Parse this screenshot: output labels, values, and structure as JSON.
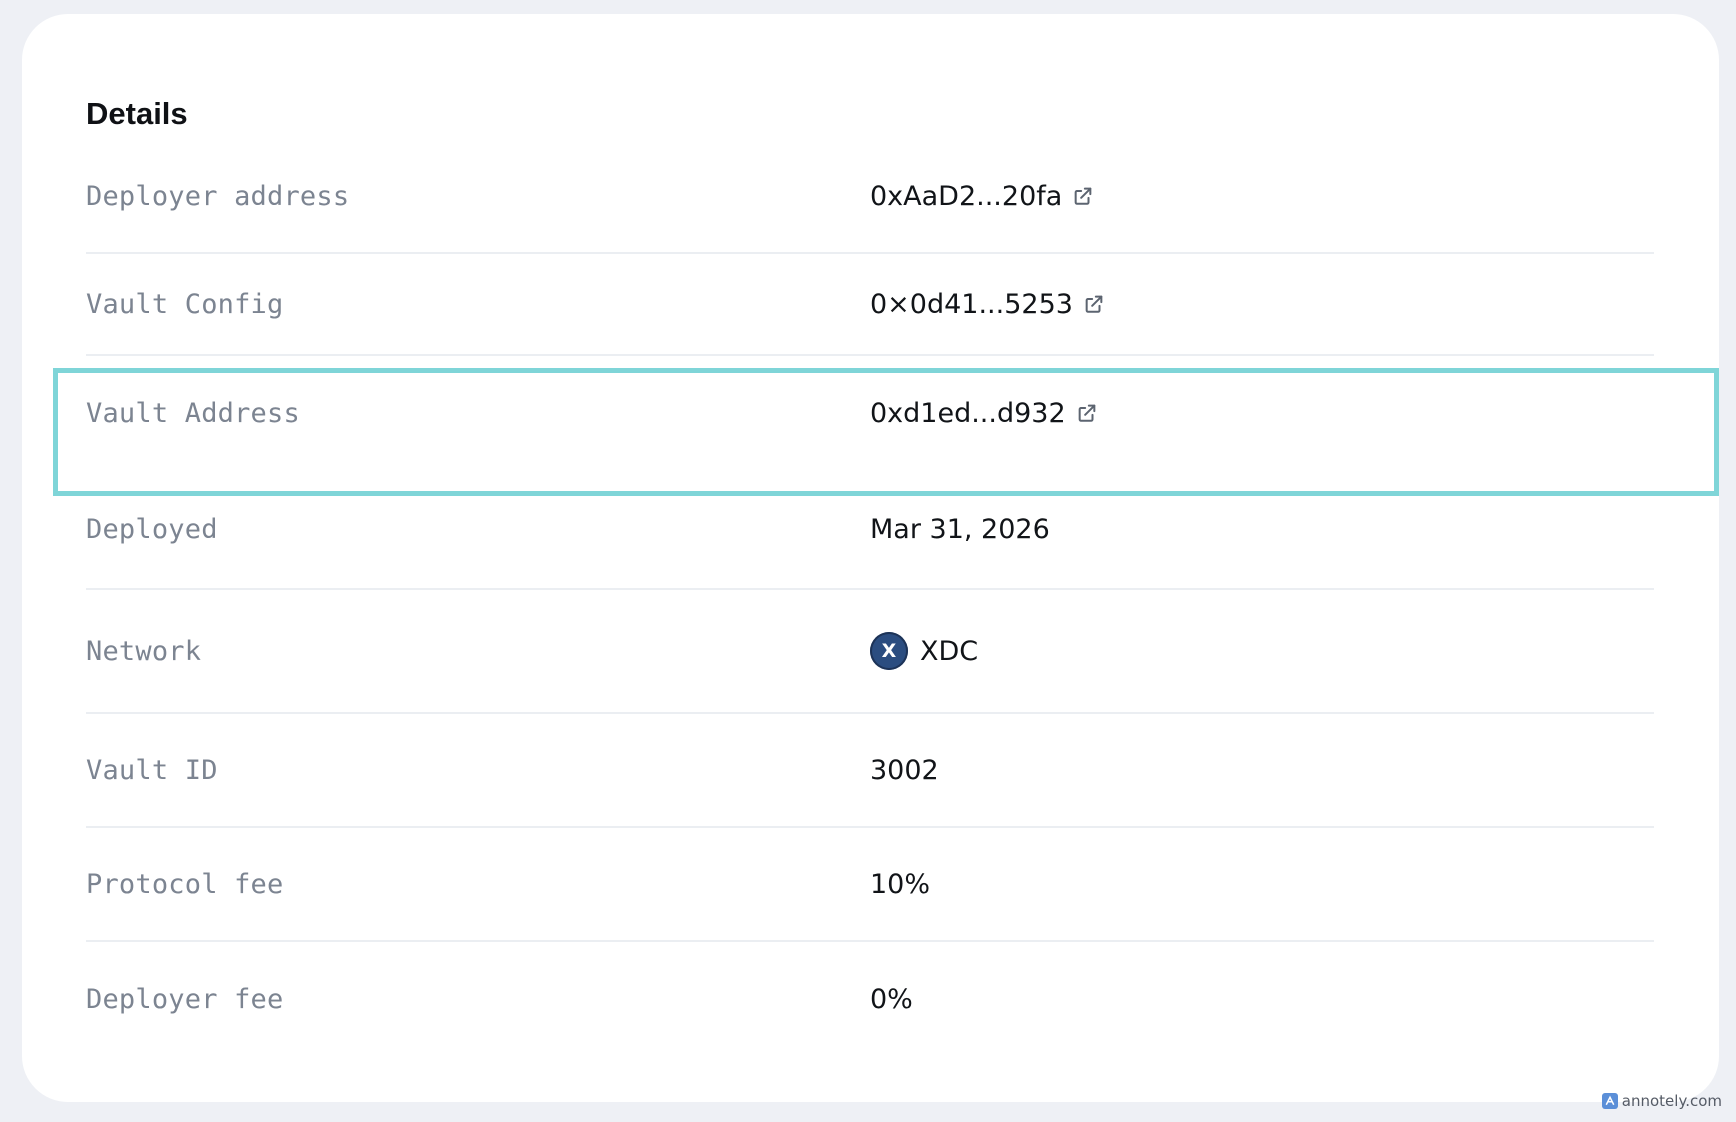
{
  "details": {
    "title": "Details",
    "rows": [
      {
        "label": "Deployer address",
        "value": "0xAaD2...20fa",
        "icon": "external-link-icon"
      },
      {
        "label": "Vault Config",
        "value": "0×0d41...5253",
        "icon": "external-link-icon"
      },
      {
        "label": "Vault Address",
        "value": "0xd1ed...d932",
        "icon": "external-link-icon"
      },
      {
        "label": "Deployed",
        "value": "Mar 31, 2026"
      },
      {
        "label": "Network",
        "value": "XDC",
        "badge_letter": "X",
        "badge_color": "#2b4d80"
      },
      {
        "label": "Vault ID",
        "value": "3002"
      },
      {
        "label": "Protocol fee",
        "value": "10%"
      },
      {
        "label": "Deployer fee",
        "value": "0%"
      }
    ]
  },
  "watermark": {
    "text": "annotely.com"
  },
  "colors": {
    "highlight": "#7fd5d8",
    "label": "#7c8491",
    "value": "#111418"
  }
}
